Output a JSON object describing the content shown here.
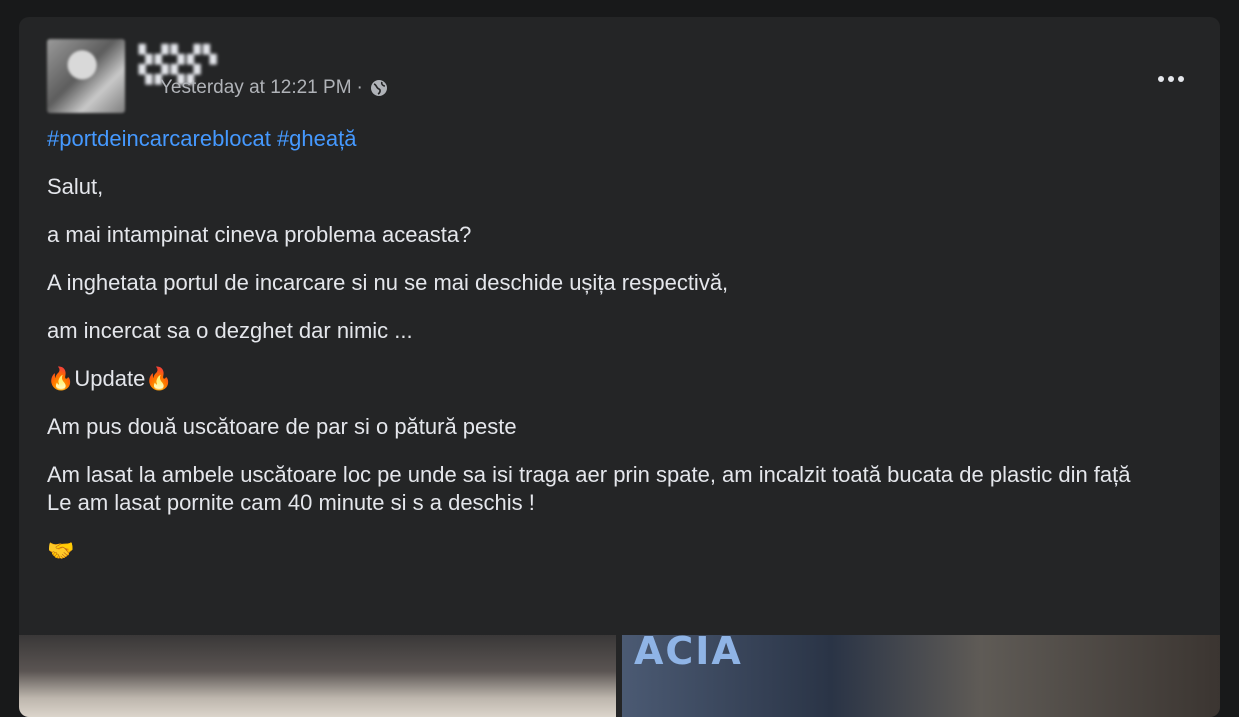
{
  "post": {
    "author": "▚▞▚▞▚ ▚▞▚▞",
    "timestamp": "Yesterday at 12:21 PM",
    "separator": "·",
    "audience_icon": "globe-icon",
    "more_icon": "more-horizontal-icon",
    "hashtags": [
      "#portdeincarcareblocat",
      "#gheață"
    ],
    "paragraphs": [
      "Salut,",
      "a mai intampinat cineva problema aceasta?",
      "A inghetata portul de incarcare si nu se mai deschide ușița respectivă,",
      "am incercat sa o dezghet dar nimic ...",
      "🔥Update🔥",
      "Am pus două uscătoare de par si o pătură peste"
    ],
    "paragraph_last": "Am lasat la ambele uscătoare loc pe unde sa isi traga aer prin spate, am incalzit toată bucata de plastic din față\nLe am lasat pornite cam 40 minute si s a deschis !",
    "closing_emoji": "🤝",
    "image_brand_text": "ACIA"
  }
}
